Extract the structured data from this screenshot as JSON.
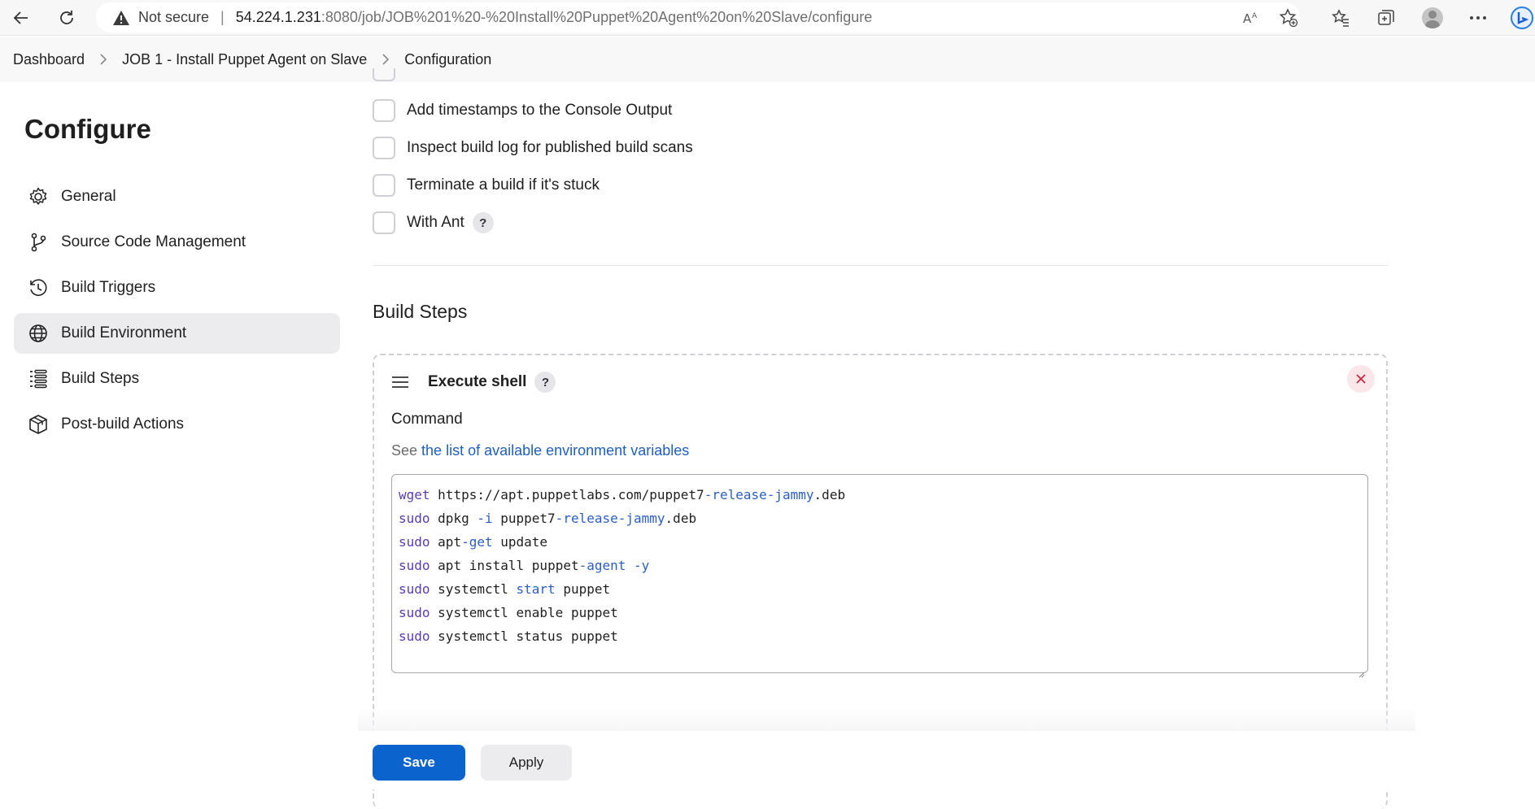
{
  "browser": {
    "not_secure": "Not secure",
    "url_host": "54.224.1.231",
    "url_path": ":8080/job/JOB%201%20-%20Install%20Puppet%20Agent%20on%20Slave/configure"
  },
  "breadcrumb": {
    "items": [
      "Dashboard",
      "JOB 1 - Install Puppet Agent on Slave",
      "Configuration"
    ]
  },
  "sidebar": {
    "title": "Configure",
    "items": [
      {
        "label": "General",
        "icon": "gear-icon"
      },
      {
        "label": "Source Code Management",
        "icon": "branch-icon"
      },
      {
        "label": "Build Triggers",
        "icon": "clock-icon"
      },
      {
        "label": "Build Environment",
        "icon": "globe-icon",
        "active": true
      },
      {
        "label": "Build Steps",
        "icon": "list-icon"
      },
      {
        "label": "Post-build Actions",
        "icon": "package-icon"
      }
    ]
  },
  "build_environment": {
    "options": [
      {
        "label": "Add timestamps to the Console Output",
        "checked": false
      },
      {
        "label": "Inspect build log for published build scans",
        "checked": false
      },
      {
        "label": "Terminate a build if it's stuck",
        "checked": false
      },
      {
        "label": "With Ant",
        "checked": false,
        "help": "?"
      }
    ]
  },
  "build_steps": {
    "title": "Build Steps",
    "step": {
      "title": "Execute shell",
      "help": "?",
      "command_label": "Command",
      "see_prefix": "See",
      "see_link": "the list of available environment variables",
      "code": [
        "wget https://apt.puppetlabs.com/puppet7-release-jammy.deb",
        "sudo dpkg -i puppet7-release-jammy.deb",
        "sudo apt-get update",
        "sudo apt install puppet-agent -y",
        "sudo systemctl start puppet",
        "sudo systemctl enable puppet",
        "sudo systemctl status puppet"
      ]
    }
  },
  "actions": {
    "save": "Save",
    "apply": "Apply"
  },
  "colors": {
    "primary": "#0b63ce",
    "active_bg": "#ececee",
    "link": "#1d5fc0"
  }
}
